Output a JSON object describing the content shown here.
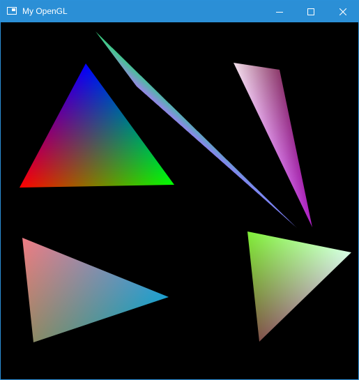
{
  "window": {
    "title": "My OpenGL",
    "accent_color": "#2b8fd6",
    "icons": {
      "app": "app-window-icon",
      "minimize": "minimize-icon",
      "maximize": "maximize-icon",
      "close": "close-icon"
    }
  },
  "scene": {
    "background_color": "#000000",
    "triangles": [
      {
        "name": "rgb-triangle",
        "colors": [
          "#0000ff",
          "#ff0000",
          "#00ff00"
        ]
      },
      {
        "name": "thin-green-blue-triangle",
        "colors": [
          "#37d27d",
          "#9a86e6",
          "#8080ff"
        ]
      },
      {
        "name": "pink-purple-triangle",
        "colors": [
          "#f2e0ea",
          "#8c3a6a",
          "#b020c8"
        ]
      },
      {
        "name": "salmon-teal-triangle",
        "colors": [
          "#f07c84",
          "#1aa0d2",
          "#8a8a66"
        ]
      },
      {
        "name": "green-mint-triangle",
        "colors": [
          "#80ee38",
          "#d8ffe8",
          "#80504a"
        ]
      }
    ]
  }
}
